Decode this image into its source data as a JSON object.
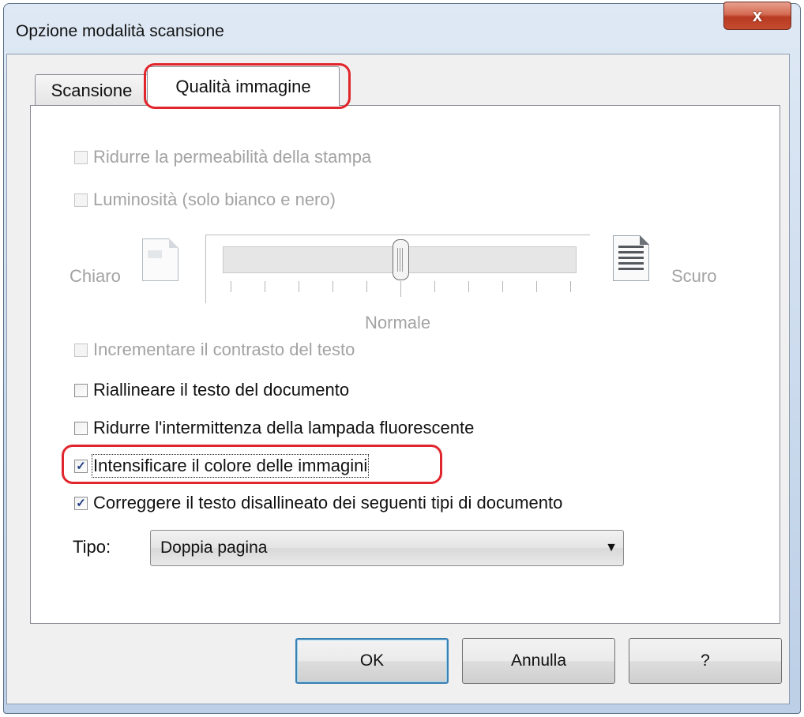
{
  "window": {
    "title": "Opzione modalità scansione",
    "close_label": "x"
  },
  "tabs": [
    {
      "label": "Scansione",
      "active": false
    },
    {
      "label": "Qualità immagine",
      "active": true
    }
  ],
  "options": {
    "reduce_bleed": {
      "label": "Ridurre la permeabilità della stampa",
      "checked": false,
      "enabled": false
    },
    "brightness": {
      "label": "Luminosità (solo bianco e nero)",
      "checked": false,
      "enabled": false
    },
    "contrast": {
      "label": "Incrementare il contrasto del testo",
      "checked": false,
      "enabled": false
    },
    "realign": {
      "label": "Riallineare il testo del documento",
      "checked": false,
      "enabled": true
    },
    "flicker": {
      "label": "Ridurre l'intermittenza della lampada fluorescente",
      "checked": false,
      "enabled": true
    },
    "intensify": {
      "label": "Intensificare il colore delle immagini",
      "checked": true,
      "enabled": true
    },
    "correct_skew": {
      "label": "Correggere il testo disallineato dei seguenti tipi di documento",
      "checked": true,
      "enabled": true
    }
  },
  "slider": {
    "left_label": "Chiaro",
    "right_label": "Scuro",
    "center_label": "Normale",
    "value_fraction": 0.5,
    "tick_count": 11
  },
  "type_select": {
    "label": "Tipo:",
    "value": "Doppia pagina"
  },
  "buttons": {
    "ok": "OK",
    "cancel": "Annulla",
    "help": "?"
  },
  "colors": {
    "highlight": "#e0262c",
    "close_button": "#c44b30",
    "checkmark": "#1f3b82"
  }
}
